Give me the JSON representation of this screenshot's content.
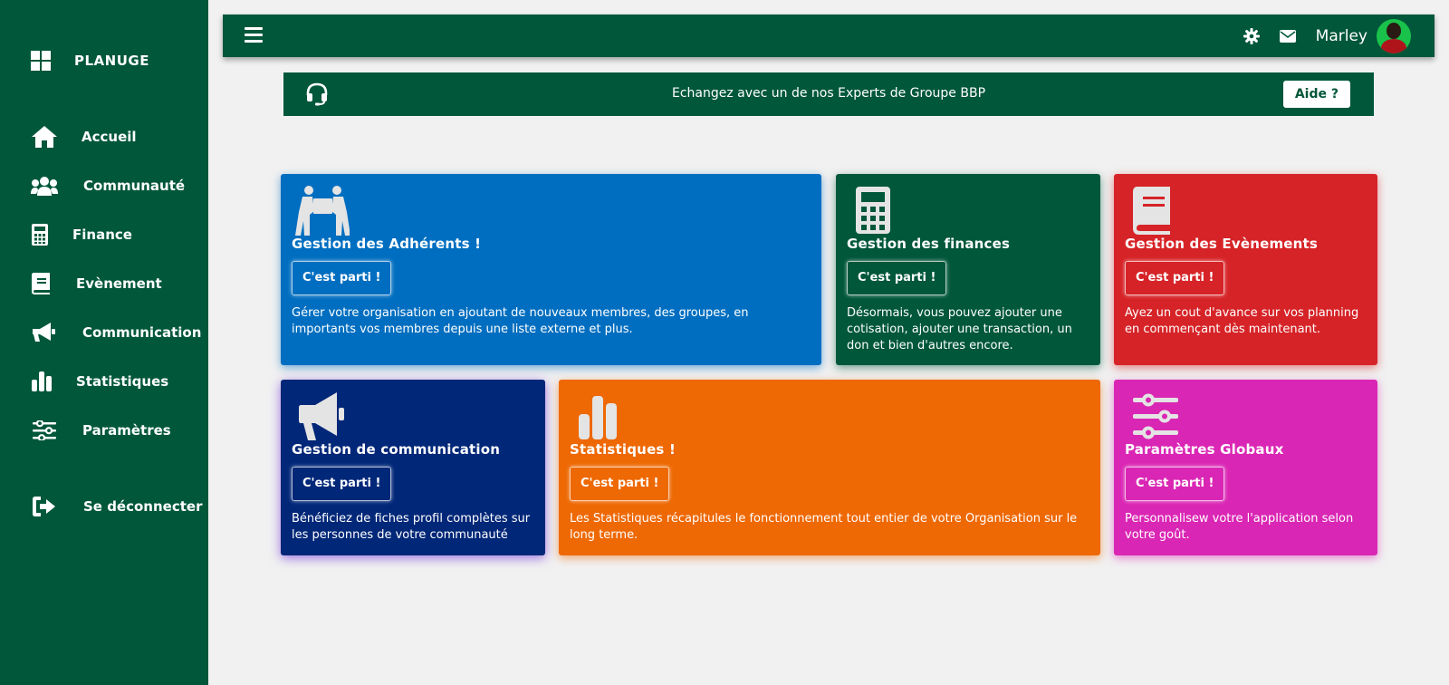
{
  "sidebar": {
    "brand": "PLANUGE",
    "items": [
      {
        "label": "Accueil",
        "icon": "home-icon"
      },
      {
        "label": "Communauté",
        "icon": "users-icon"
      },
      {
        "label": "Finance",
        "icon": "calculator-icon"
      },
      {
        "label": "Evènement",
        "icon": "book-icon"
      },
      {
        "label": "Communication",
        "icon": "megaphone-icon"
      },
      {
        "label": "Statistiques",
        "icon": "bar-chart-icon"
      },
      {
        "label": "Paramètres",
        "icon": "sliders-icon"
      },
      {
        "label": "Se déconnecter",
        "icon": "logout-icon"
      }
    ]
  },
  "topbar": {
    "username": "Marley",
    "icons": [
      "menu-icon",
      "gear-icon",
      "envelope-icon"
    ]
  },
  "banner": {
    "text": "Echangez avec un de nos Experts de Groupe BBP",
    "button": "Aide ?",
    "icon": "headset-icon"
  },
  "cards": [
    {
      "title": "Gestion des Adhérents !",
      "button": "C'est parti !",
      "desc": "Gérer votre organisation en ajoutant de nouveaux membres, des groupes, en importants vos membres depuis une liste externe et plus.",
      "icon": "people-carry-icon",
      "color": "#006ec0"
    },
    {
      "title": "Gestion des finances",
      "button": "C'est parti !",
      "desc": "Désormais, vous pouvez ajouter une cotisation, ajouter une transaction, un don et bien d'autres encore.",
      "icon": "calculator-icon",
      "color": "#00573a"
    },
    {
      "title": "Gestion des Evènements",
      "button": "C'est parti !",
      "desc": "Ayez un cout d'avance sur vos planning en commençant dès maintenant.",
      "icon": "book-icon",
      "color": "#d62327"
    },
    {
      "title": "Gestion de communication",
      "button": "C'est parti !",
      "desc": "Bénéficiez de fiches profil complètes sur les personnes de votre communauté",
      "icon": "megaphone-icon",
      "color": "#012778"
    },
    {
      "title": "Statistiques !",
      "button": "C'est parti !",
      "desc": "Les Statistiques récapitules le fonctionnement tout entier de votre Organisation sur le long terme.",
      "icon": "bar-chart-icon",
      "color": "#ee6803"
    },
    {
      "title": "Paramètres Globaux",
      "button": "C'est parti !",
      "desc": "Personnalisew votre l'application selon votre goût.",
      "icon": "sliders-icon",
      "color": "#da26b4"
    }
  ]
}
